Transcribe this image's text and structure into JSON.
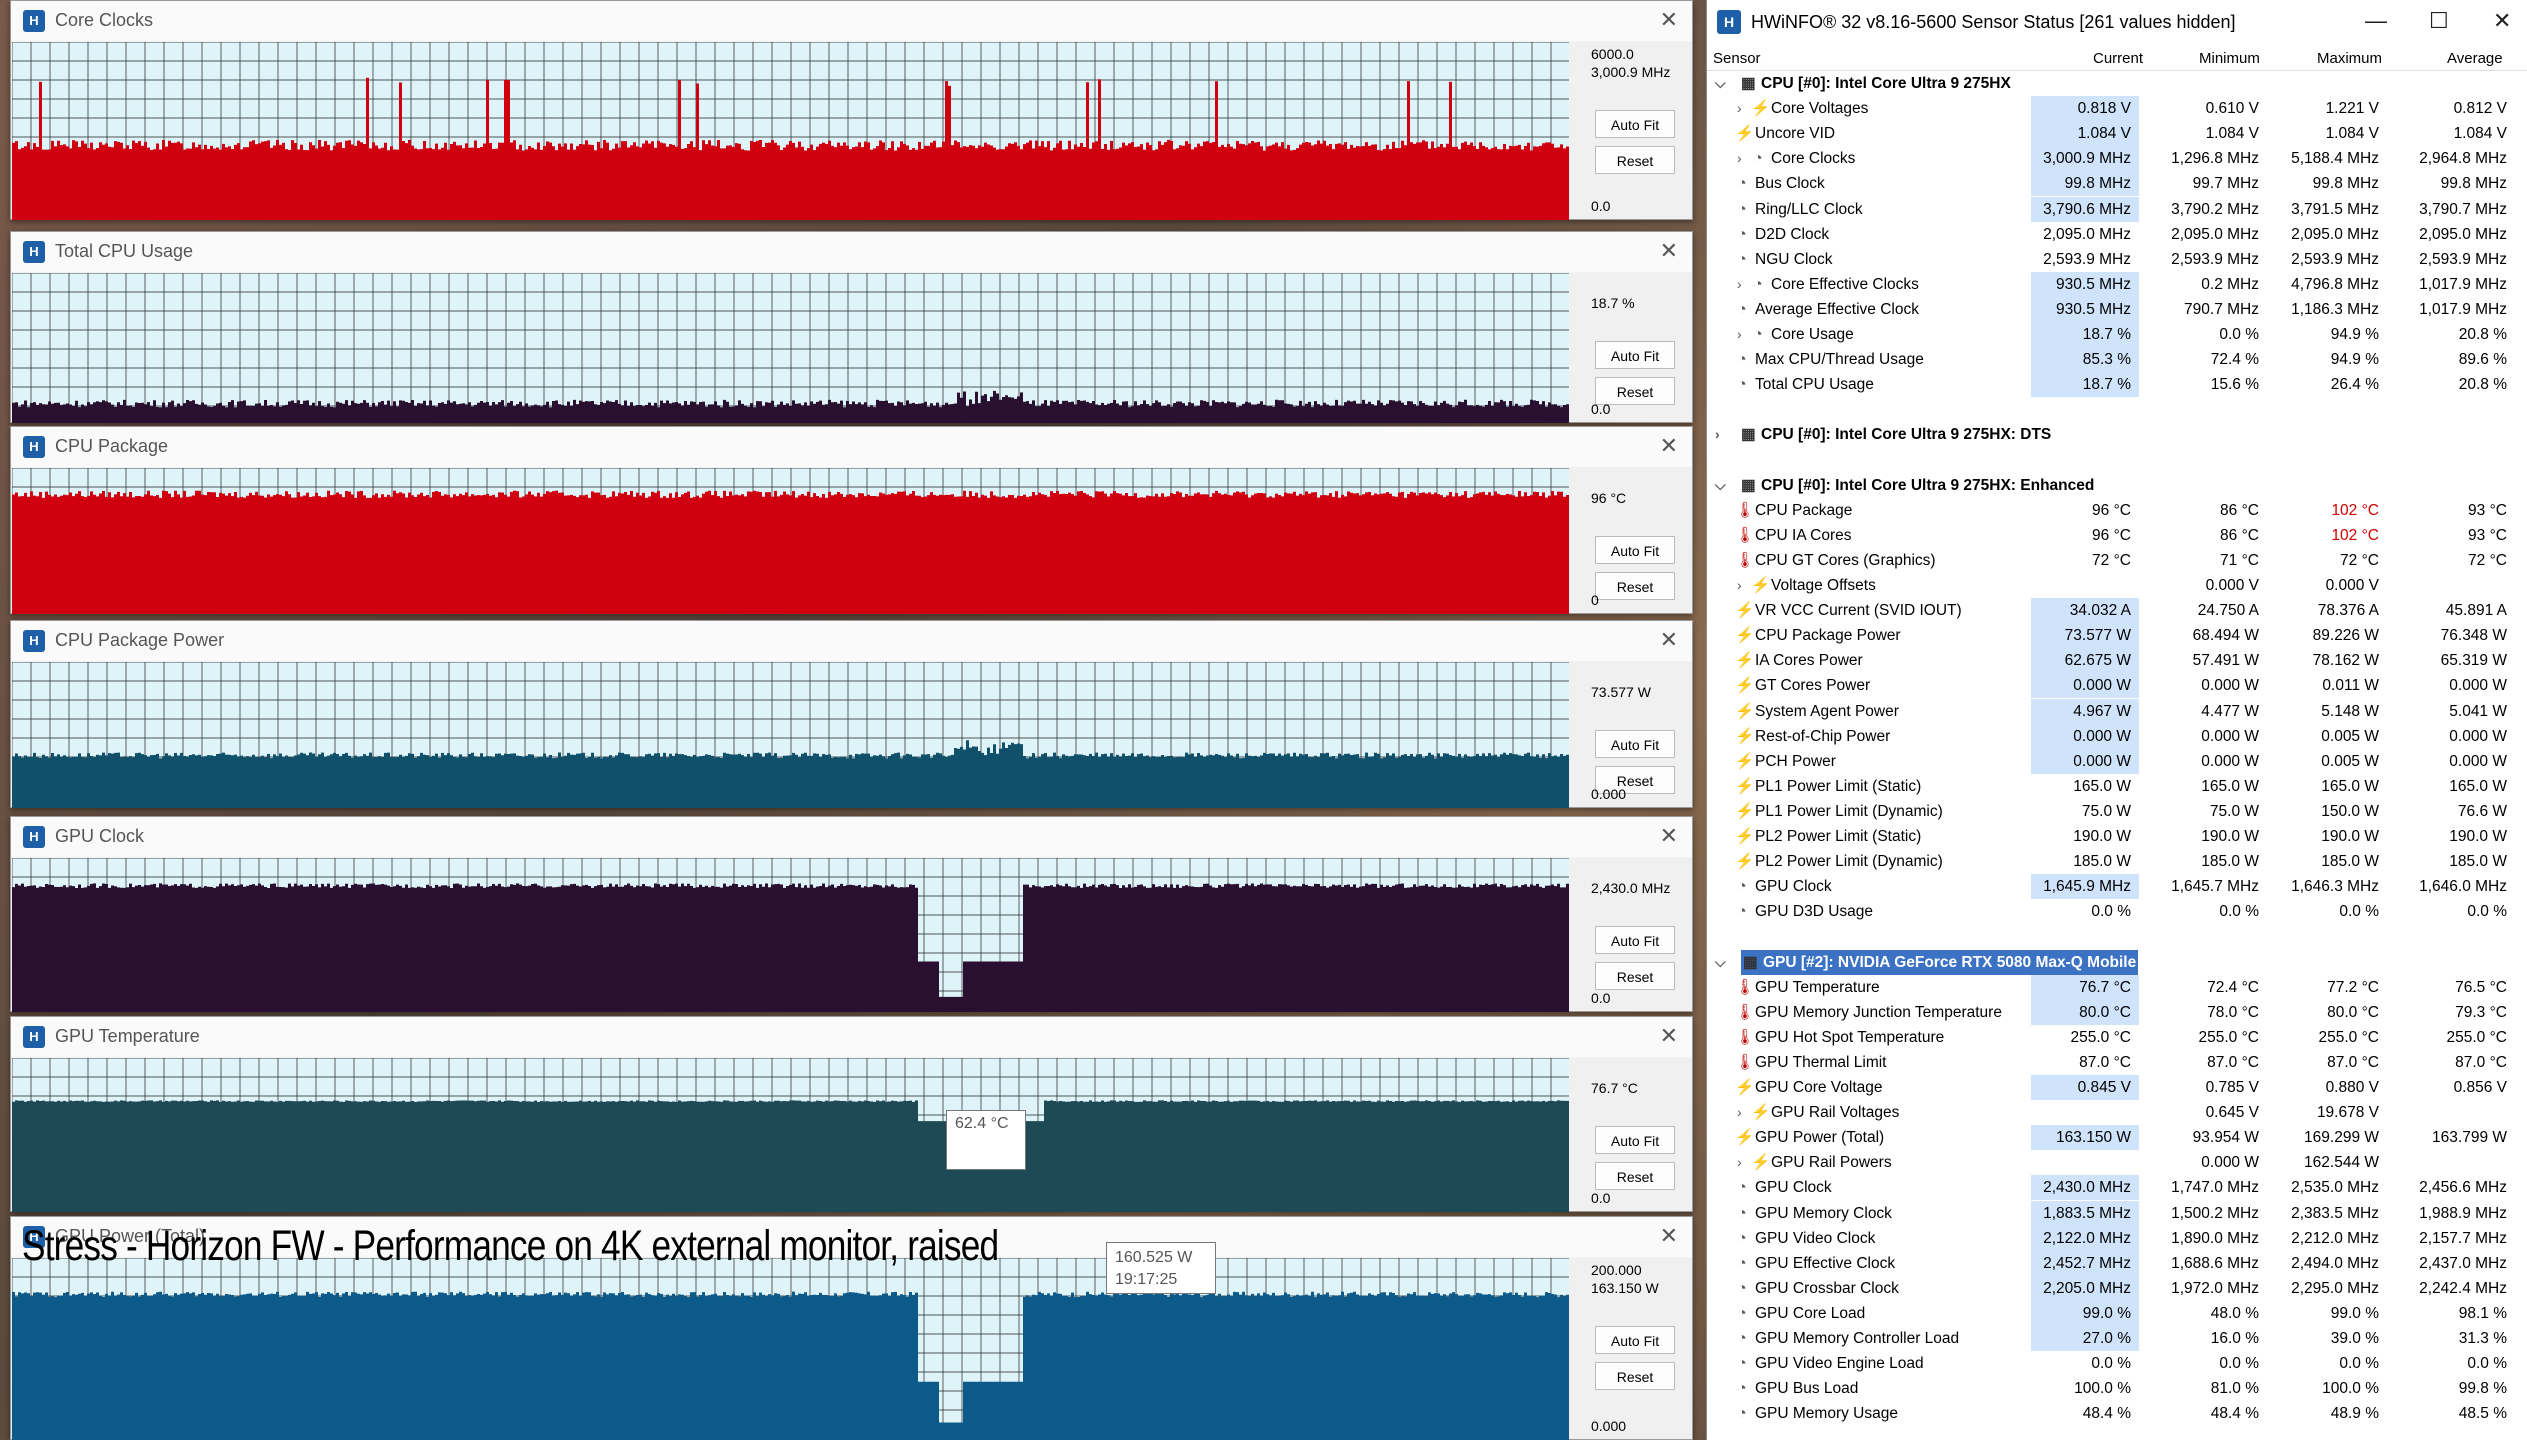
{
  "graphs": [
    {
      "id": "core-clocks",
      "title": "Core Clocks",
      "top_value": "6000.0",
      "cur_value": "3,000.9 MHz",
      "bottom_value": "0.0",
      "color": "#d00010",
      "base": 0.42,
      "noise": 0.06
    },
    {
      "id": "total-cpu-usage",
      "title": "Total CPU Usage",
      "top_value": "",
      "cur_value": "18.7 %",
      "bottom_value": "0.0",
      "color": "#2a1030",
      "base": 0.13,
      "noise": 0.05
    },
    {
      "id": "cpu-package",
      "title": "CPU Package",
      "top_value": "",
      "cur_value": "96 °C",
      "bottom_value": "0",
      "color": "#d00010",
      "base": 0.82,
      "noise": 0.05
    },
    {
      "id": "cpu-package-power",
      "title": "CPU Package Power",
      "top_value": "",
      "cur_value": "73.577 W",
      "bottom_value": "0.000",
      "color": "#10506a",
      "base": 0.36,
      "noise": 0.04
    },
    {
      "id": "gpu-clock",
      "title": "GPU Clock",
      "top_value": "",
      "cur_value": "2,430.0 MHz",
      "bottom_value": "0.0",
      "color": "#2a1030",
      "base": 0.82,
      "noise": 0.03
    },
    {
      "id": "gpu-temperature",
      "title": "GPU Temperature",
      "top_value": "",
      "cur_value": "76.7 °C",
      "bottom_value": "0.0",
      "color": "#1d4a55",
      "base": 0.72,
      "noise": 0.01
    },
    {
      "id": "gpu-power",
      "title": "GPU Power (Total)",
      "top_value": "200.000",
      "cur_value": "163.150 W",
      "bottom_value": "0.000",
      "color": "#0b5a8a",
      "base": 0.8,
      "noise": 0.03
    }
  ],
  "buttons": {
    "autofit": "Auto Fit",
    "reset": "Reset"
  },
  "caption": "Stress - Horizon FW - Performance on 4K external monitor, raised",
  "tooltips": {
    "gpu_temp": "62.4 °C",
    "gpu_power_value": "160.525 W",
    "gpu_power_time": "19:17:25"
  },
  "hwinfo": {
    "title": "HWiNFO® 32 v8.16-5600 Sensor Status [261 values hidden]",
    "columns": [
      "Sensor",
      "Current",
      "Minimum",
      "Maximum",
      "Average"
    ],
    "rows": [
      {
        "t": "group",
        "n": "CPU [#0]: Intel Core Ultra 9 275HX",
        "exp": "open"
      },
      {
        "t": "row",
        "i": "bolt",
        "n": "Core Voltages",
        "sub": 1,
        "c": "0.818 V",
        "mn": "0.610 V",
        "mx": "1.221 V",
        "av": "0.812 V",
        "hl": 1
      },
      {
        "t": "row",
        "i": "bolt",
        "n": "Uncore VID",
        "c": "1.084 V",
        "mn": "1.084 V",
        "mx": "1.084 V",
        "av": "1.084 V",
        "hl": 1
      },
      {
        "t": "row",
        "i": "clk",
        "n": "Core Clocks",
        "sub": 1,
        "c": "3,000.9 MHz",
        "mn": "1,296.8 MHz",
        "mx": "5,188.4 MHz",
        "av": "2,964.8 MHz",
        "hl": 1
      },
      {
        "t": "row",
        "i": "clk",
        "n": "Bus Clock",
        "c": "99.8 MHz",
        "mn": "99.7 MHz",
        "mx": "99.8 MHz",
        "av": "99.8 MHz",
        "hl": 1
      },
      {
        "t": "row",
        "i": "clk",
        "n": "Ring/LLC Clock",
        "c": "3,790.6 MHz",
        "mn": "3,790.2 MHz",
        "mx": "3,791.5 MHz",
        "av": "3,790.7 MHz",
        "hl": 1
      },
      {
        "t": "row",
        "i": "clk",
        "n": "D2D Clock",
        "c": "2,095.0 MHz",
        "mn": "2,095.0 MHz",
        "mx": "2,095.0 MHz",
        "av": "2,095.0 MHz",
        "hl": 0
      },
      {
        "t": "row",
        "i": "clk",
        "n": "NGU Clock",
        "c": "2,593.9 MHz",
        "mn": "2,593.9 MHz",
        "mx": "2,593.9 MHz",
        "av": "2,593.9 MHz",
        "hl": 0
      },
      {
        "t": "row",
        "i": "clk",
        "n": "Core Effective Clocks",
        "sub": 1,
        "c": "930.5 MHz",
        "mn": "0.2 MHz",
        "mx": "4,796.8 MHz",
        "av": "1,017.9 MHz",
        "hl": 1
      },
      {
        "t": "row",
        "i": "clk",
        "n": "Average Effective Clock",
        "c": "930.5 MHz",
        "mn": "790.7 MHz",
        "mx": "1,186.3 MHz",
        "av": "1,017.9 MHz",
        "hl": 1
      },
      {
        "t": "row",
        "i": "clk",
        "n": "Core Usage",
        "sub": 1,
        "c": "18.7 %",
        "mn": "0.0 %",
        "mx": "94.9 %",
        "av": "20.8 %",
        "hl": 1
      },
      {
        "t": "row",
        "i": "clk",
        "n": "Max CPU/Thread Usage",
        "c": "85.3 %",
        "mn": "72.4 %",
        "mx": "94.9 %",
        "av": "89.6 %",
        "hl": 1
      },
      {
        "t": "row",
        "i": "clk",
        "n": "Total CPU Usage",
        "c": "18.7 %",
        "mn": "15.6 %",
        "mx": "26.4 %",
        "av": "20.8 %",
        "hl": 1
      },
      {
        "t": "blank"
      },
      {
        "t": "group",
        "n": "CPU [#0]: Intel Core Ultra 9 275HX: DTS",
        "exp": "closed"
      },
      {
        "t": "blank"
      },
      {
        "t": "group",
        "n": "CPU [#0]: Intel Core Ultra 9 275HX: Enhanced",
        "exp": "open"
      },
      {
        "t": "row",
        "i": "therm",
        "n": "CPU Package",
        "c": "96 °C",
        "mn": "86 °C",
        "mx": "102 °C",
        "av": "93 °C",
        "hl": 0,
        "red": 1
      },
      {
        "t": "row",
        "i": "therm",
        "n": "CPU IA Cores",
        "c": "96 °C",
        "mn": "86 °C",
        "mx": "102 °C",
        "av": "93 °C",
        "hl": 0,
        "red": 1
      },
      {
        "t": "row",
        "i": "therm",
        "n": "CPU GT Cores (Graphics)",
        "c": "72 °C",
        "mn": "71 °C",
        "mx": "72 °C",
        "av": "72 °C",
        "hl": 0
      },
      {
        "t": "row",
        "i": "bolt",
        "n": "Voltage Offsets",
        "sub": 1,
        "c": "",
        "mn": "0.000 V",
        "mx": "0.000 V",
        "av": "",
        "hl": 0
      },
      {
        "t": "row",
        "i": "bolt",
        "n": "VR VCC Current (SVID IOUT)",
        "c": "34.032 A",
        "mn": "24.750 A",
        "mx": "78.376 A",
        "av": "45.891 A",
        "hl": 1
      },
      {
        "t": "row",
        "i": "bolt",
        "n": "CPU Package Power",
        "c": "73.577 W",
        "mn": "68.494 W",
        "mx": "89.226 W",
        "av": "76.348 W",
        "hl": 1
      },
      {
        "t": "row",
        "i": "bolt",
        "n": "IA Cores Power",
        "c": "62.675 W",
        "mn": "57.491 W",
        "mx": "78.162 W",
        "av": "65.319 W",
        "hl": 1
      },
      {
        "t": "row",
        "i": "bolt",
        "n": "GT Cores Power",
        "c": "0.000 W",
        "mn": "0.000 W",
        "mx": "0.011 W",
        "av": "0.000 W",
        "hl": 1
      },
      {
        "t": "row",
        "i": "bolt",
        "n": "System Agent Power",
        "c": "4.967 W",
        "mn": "4.477 W",
        "mx": "5.148 W",
        "av": "5.041 W",
        "hl": 1
      },
      {
        "t": "row",
        "i": "bolt",
        "n": "Rest-of-Chip Power",
        "c": "0.000 W",
        "mn": "0.000 W",
        "mx": "0.005 W",
        "av": "0.000 W",
        "hl": 1
      },
      {
        "t": "row",
        "i": "bolt",
        "n": "PCH Power",
        "c": "0.000 W",
        "mn": "0.000 W",
        "mx": "0.005 W",
        "av": "0.000 W",
        "hl": 1
      },
      {
        "t": "row",
        "i": "bolt",
        "n": "PL1 Power Limit (Static)",
        "c": "165.0 W",
        "mn": "165.0 W",
        "mx": "165.0 W",
        "av": "165.0 W",
        "hl": 0
      },
      {
        "t": "row",
        "i": "bolt",
        "n": "PL1 Power Limit (Dynamic)",
        "c": "75.0 W",
        "mn": "75.0 W",
        "mx": "150.0 W",
        "av": "76.6 W",
        "hl": 0
      },
      {
        "t": "row",
        "i": "bolt",
        "n": "PL2 Power Limit (Static)",
        "c": "190.0 W",
        "mn": "190.0 W",
        "mx": "190.0 W",
        "av": "190.0 W",
        "hl": 0
      },
      {
        "t": "row",
        "i": "bolt",
        "n": "PL2 Power Limit (Dynamic)",
        "c": "185.0 W",
        "mn": "185.0 W",
        "mx": "185.0 W",
        "av": "185.0 W",
        "hl": 0
      },
      {
        "t": "row",
        "i": "clk",
        "n": "GPU Clock",
        "c": "1,645.9 MHz",
        "mn": "1,645.7 MHz",
        "mx": "1,646.3 MHz",
        "av": "1,646.0 MHz",
        "hl": 1
      },
      {
        "t": "row",
        "i": "clk",
        "n": "GPU D3D Usage",
        "c": "0.0 %",
        "mn": "0.0 %",
        "mx": "0.0 %",
        "av": "0.0 %",
        "hl": 0
      },
      {
        "t": "blank"
      },
      {
        "t": "group",
        "n": "GPU [#2]: NVIDIA  GeForce RTX 5080 Max-Q Mobile",
        "exp": "open",
        "sel": 1
      },
      {
        "t": "row",
        "i": "therm",
        "n": "GPU Temperature",
        "c": "76.7 °C",
        "mn": "72.4 °C",
        "mx": "77.2 °C",
        "av": "76.5 °C",
        "hl": 1
      },
      {
        "t": "row",
        "i": "therm",
        "n": "GPU Memory Junction Temperature",
        "c": "80.0 °C",
        "mn": "78.0 °C",
        "mx": "80.0 °C",
        "av": "79.3 °C",
        "hl": 1
      },
      {
        "t": "row",
        "i": "therm",
        "n": "GPU Hot Spot Temperature",
        "c": "255.0 °C",
        "mn": "255.0 °C",
        "mx": "255.0 °C",
        "av": "255.0 °C",
        "hl": 0
      },
      {
        "t": "row",
        "i": "therm",
        "n": "GPU Thermal Limit",
        "c": "87.0 °C",
        "mn": "87.0 °C",
        "mx": "87.0 °C",
        "av": "87.0 °C",
        "hl": 0
      },
      {
        "t": "row",
        "i": "bolt",
        "n": "GPU Core Voltage",
        "c": "0.845 V",
        "mn": "0.785 V",
        "mx": "0.880 V",
        "av": "0.856 V",
        "hl": 1
      },
      {
        "t": "row",
        "i": "bolt",
        "n": "GPU Rail Voltages",
        "sub": 1,
        "c": "",
        "mn": "0.645 V",
        "mx": "19.678 V",
        "av": "",
        "hl": 0
      },
      {
        "t": "row",
        "i": "bolt",
        "n": "GPU Power (Total)",
        "c": "163.150 W",
        "mn": "93.954 W",
        "mx": "169.299 W",
        "av": "163.799 W",
        "hl": 1
      },
      {
        "t": "row",
        "i": "bolt",
        "n": "GPU Rail Powers",
        "sub": 1,
        "c": "",
        "mn": "0.000 W",
        "mx": "162.544 W",
        "av": "",
        "hl": 0
      },
      {
        "t": "row",
        "i": "clk",
        "n": "GPU Clock",
        "c": "2,430.0 MHz",
        "mn": "1,747.0 MHz",
        "mx": "2,535.0 MHz",
        "av": "2,456.6 MHz",
        "hl": 1
      },
      {
        "t": "row",
        "i": "clk",
        "n": "GPU Memory Clock",
        "c": "1,883.5 MHz",
        "mn": "1,500.2 MHz",
        "mx": "2,383.5 MHz",
        "av": "1,988.9 MHz",
        "hl": 1
      },
      {
        "t": "row",
        "i": "clk",
        "n": "GPU Video Clock",
        "c": "2,122.0 MHz",
        "mn": "1,890.0 MHz",
        "mx": "2,212.0 MHz",
        "av": "2,157.7 MHz",
        "hl": 1
      },
      {
        "t": "row",
        "i": "clk",
        "n": "GPU Effective Clock",
        "c": "2,452.7 MHz",
        "mn": "1,688.6 MHz",
        "mx": "2,494.0 MHz",
        "av": "2,437.0 MHz",
        "hl": 1
      },
      {
        "t": "row",
        "i": "clk",
        "n": "GPU Crossbar Clock",
        "c": "2,205.0 MHz",
        "mn": "1,972.0 MHz",
        "mx": "2,295.0 MHz",
        "av": "2,242.4 MHz",
        "hl": 1
      },
      {
        "t": "row",
        "i": "clk",
        "n": "GPU Core Load",
        "c": "99.0 %",
        "mn": "48.0 %",
        "mx": "99.0 %",
        "av": "98.1 %",
        "hl": 1
      },
      {
        "t": "row",
        "i": "clk",
        "n": "GPU Memory Controller Load",
        "c": "27.0 %",
        "mn": "16.0 %",
        "mx": "39.0 %",
        "av": "31.3 %",
        "hl": 1
      },
      {
        "t": "row",
        "i": "clk",
        "n": "GPU Video Engine Load",
        "c": "0.0 %",
        "mn": "0.0 %",
        "mx": "0.0 %",
        "av": "0.0 %",
        "hl": 0
      },
      {
        "t": "row",
        "i": "clk",
        "n": "GPU Bus Load",
        "c": "100.0 %",
        "mn": "81.0 %",
        "mx": "100.0 %",
        "av": "99.8 %",
        "hl": 0
      },
      {
        "t": "row",
        "i": "clk",
        "n": "GPU Memory Usage",
        "c": "48.4 %",
        "mn": "48.4 %",
        "mx": "48.9 %",
        "av": "48.5 %",
        "hl": 0
      }
    ]
  }
}
